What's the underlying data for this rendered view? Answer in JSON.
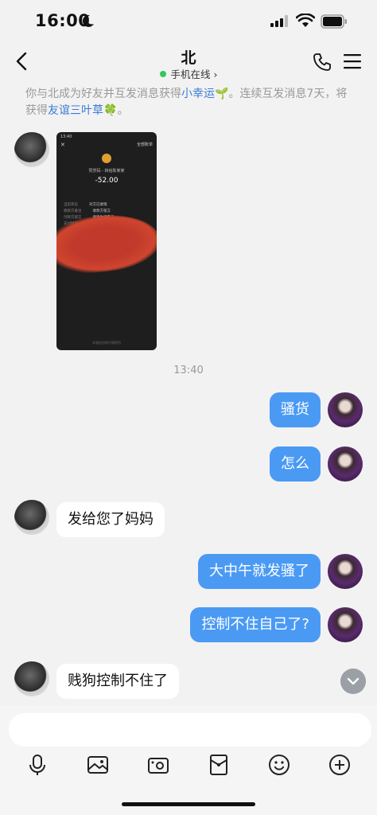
{
  "status_bar": {
    "time": "16:00"
  },
  "header": {
    "title": "北",
    "online_status": "手机在线"
  },
  "system_message": {
    "text_before": "你与北成为好友并互发消息获得",
    "link1": "小幸运",
    "link1_emoji": "🌱",
    "text_middle": "。连续互发消息7天，将获得",
    "link2": "友谊三叶草",
    "link2_emoji": "🍀",
    "text_after": "。"
  },
  "image_message": {
    "time": "13:40",
    "close": "✕",
    "all_bills": "全部账单",
    "merchant": "赞赏码 - 转给陈某某",
    "amount": "-52.00",
    "rows": [
      {
        "label": "当前状态",
        "value": "对方已收钱"
      },
      {
        "label": "收款方备注",
        "value": "收款方留言"
      },
      {
        "label": "付款方留言",
        "value": "谢谢你请客了"
      },
      {
        "label": "支付时间",
        "value": "2023年"
      }
    ],
    "footer": "本服务由财付通提供"
  },
  "timestamp": "13:40",
  "messages": [
    {
      "side": "right",
      "text": "骚货"
    },
    {
      "side": "right",
      "text": "怎么"
    },
    {
      "side": "left",
      "text": "发给您了妈妈"
    },
    {
      "side": "right",
      "text": "大中午就发骚了"
    },
    {
      "side": "right",
      "text": "控制不住自己了?"
    },
    {
      "side": "left",
      "text": "贱狗控制不住了"
    }
  ],
  "input": {
    "placeholder": ""
  },
  "toolbar": [
    "microphone-icon",
    "image-icon",
    "camera-icon",
    "red-packet-icon",
    "emoji-icon",
    "plus-icon"
  ],
  "colors": {
    "bubble_right": "#4a9af4",
    "bubble_left": "#ffffff",
    "link": "#3a7bd5",
    "online": "#34c759"
  }
}
